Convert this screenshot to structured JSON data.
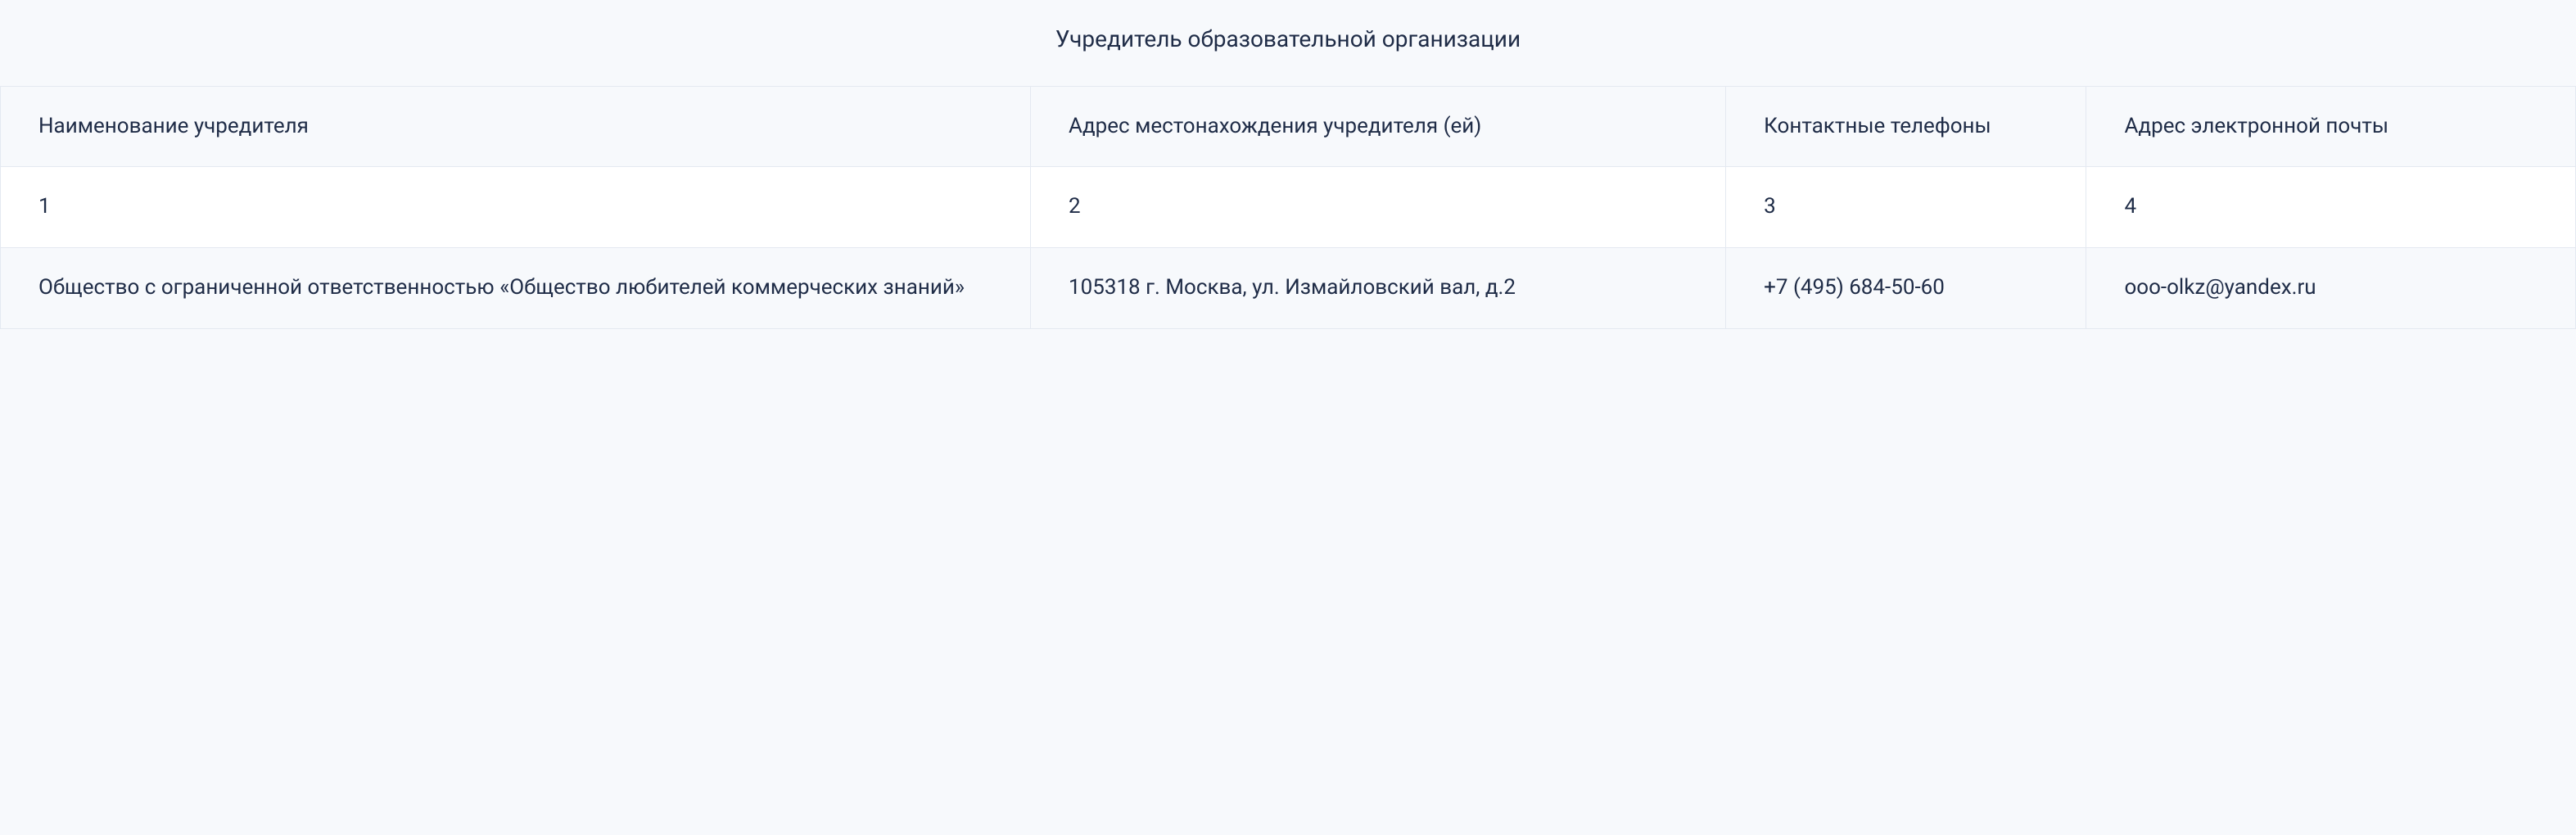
{
  "table": {
    "caption": "Учредитель образовательной организации",
    "headers": {
      "name": "Наименование учредителя",
      "address": "Адрес местонахождения учредителя (ей)",
      "phone": "Контактные телефоны",
      "email": "Адрес электронной почты"
    },
    "num_row": {
      "c1": "1",
      "c2": "2",
      "c3": "3",
      "c4": "4"
    },
    "data_row": {
      "name": "Общество с ограниченной ответственностью «Общество любителей коммерческих знаний»",
      "address": "105318 г. Москва, ул. Измайловский вал, д.2",
      "phone": "+7 (495) 684-50-60",
      "email": "ooo-olkz@yandex.ru"
    }
  }
}
